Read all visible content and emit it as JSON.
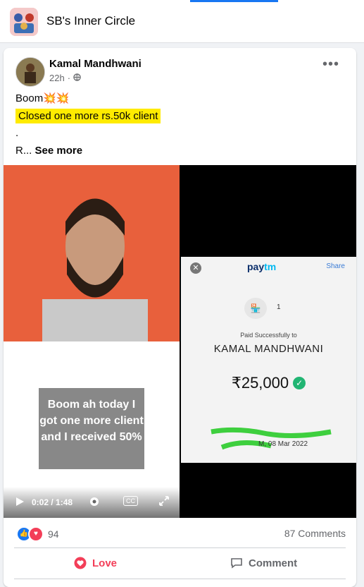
{
  "group": {
    "title": "SB's Inner Circle",
    "icon": "group-photo-icon"
  },
  "post": {
    "author": "Kamal Mandhwani",
    "time": "22h",
    "privacy_icon": "globe-icon",
    "lines": {
      "line1": "Boom💥💥",
      "highlight": "Closed one more rs.50k client",
      "line3": ".",
      "line4_prefix": "R...",
      "see_more": "See more"
    }
  },
  "video": {
    "caption": "Boom ah today I got one more client and I received 50%",
    "time": "0:02 / 1:48",
    "cc": "CC"
  },
  "paytm": {
    "logo_a": "pay",
    "logo_b": "tm",
    "share": "Share",
    "count": "1",
    "paid_text": "Paid Successfully to",
    "name": "KAMAL MANDHWANI",
    "amount": "₹25,000",
    "date": "M, 08 Mar 2022"
  },
  "stats": {
    "reactions": "94",
    "comments": "87 Comments"
  },
  "actions": {
    "love": "Love",
    "comment": "Comment"
  },
  "colors": {
    "accent": "#1877f2",
    "love": "#f33e58",
    "highlight": "#ffeb00"
  }
}
